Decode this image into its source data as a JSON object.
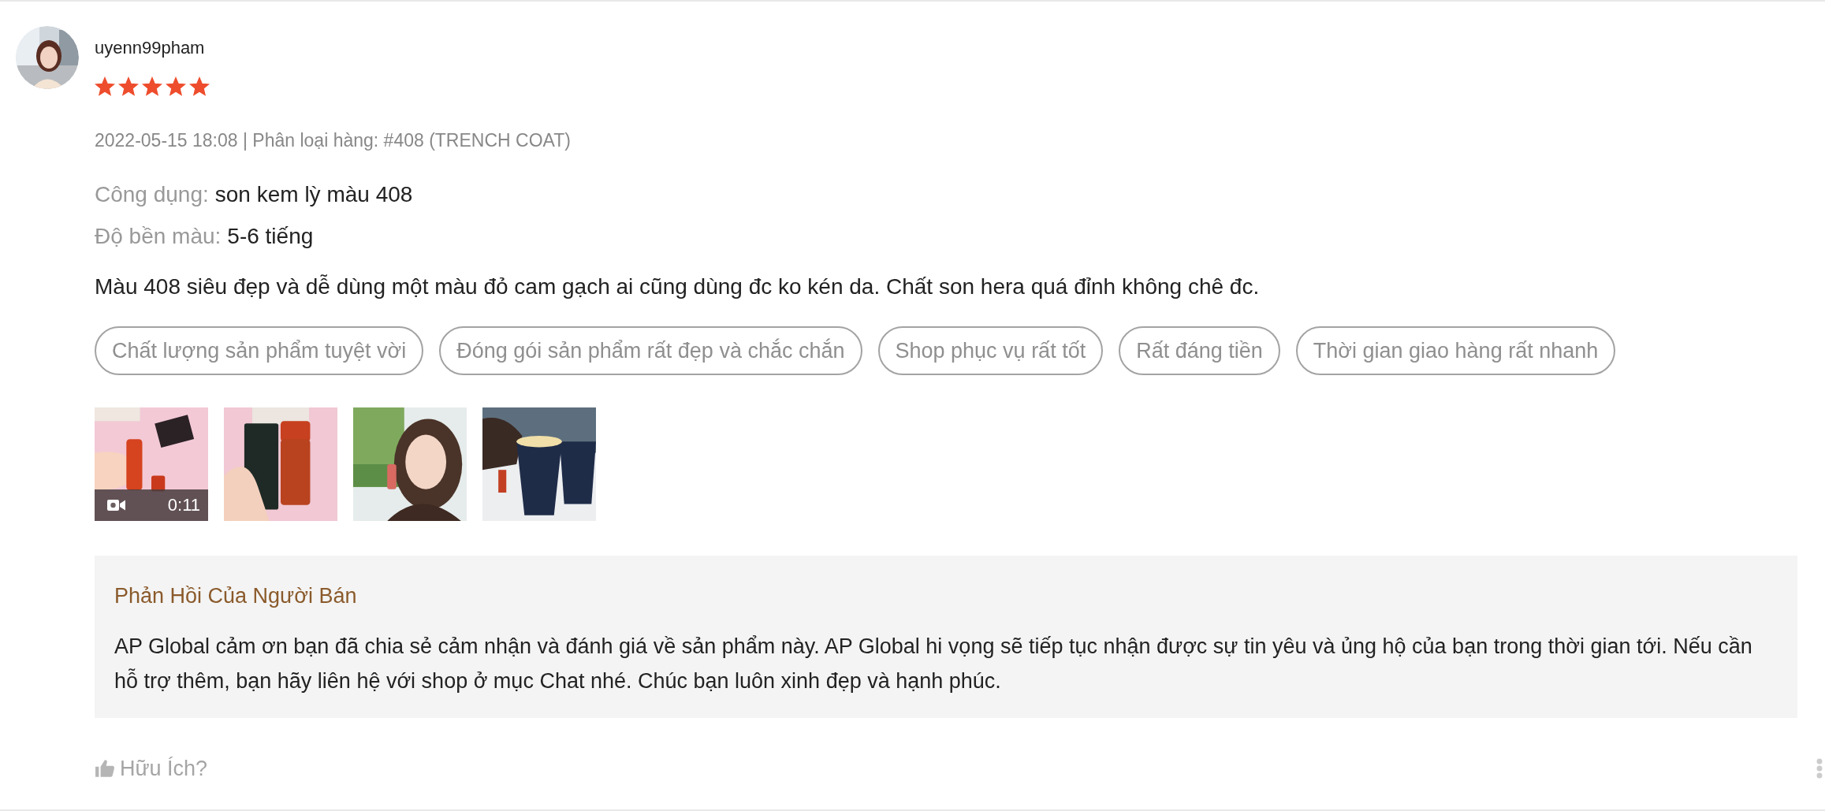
{
  "review": {
    "username": "uyenn99pham",
    "stars": 5,
    "meta": "2022-05-15 18:08 | Phân loại hàng: #408 (TRENCH COAT)",
    "attributes": [
      {
        "label": "Công dụng:",
        "value": "son kem lỳ màu 408"
      },
      {
        "label": "Độ bền màu:",
        "value": "5-6 tiếng"
      }
    ],
    "comment": "Màu 408 siêu đẹp và dễ dùng một màu đỏ cam gạch ai cũng dùng đc ko kén da. Chất son hera quá đỉnh không chê đc.",
    "tags": [
      "Chất lượng sản phẩm tuyệt vời",
      "Đóng gói sản phẩm rất đẹp và chắc chắn",
      "Shop phục vụ rất tốt",
      "Rất đáng tiền",
      "Thời gian giao hàng rất nhanh"
    ],
    "media": [
      {
        "kind": "video",
        "duration": "0:11"
      },
      {
        "kind": "picture"
      },
      {
        "kind": "picture"
      },
      {
        "kind": "picture"
      }
    ]
  },
  "seller_reply": {
    "title": "Phản Hồi Của Người Bán",
    "text": "AP Global cảm ơn bạn đã chia sẻ cảm nhận và đánh giá về sản phẩm này. AP Global hi vọng sẽ tiếp tục nhận được sự tin yêu và ủng hộ của bạn trong thời gian tới. Nếu cần hỗ trợ thêm, bạn hãy liên hệ với shop ở mục Chat nhé. Chúc bạn luôn xinh đẹp và hạnh phúc."
  },
  "helpful": {
    "label": "Hữu Ích?"
  }
}
